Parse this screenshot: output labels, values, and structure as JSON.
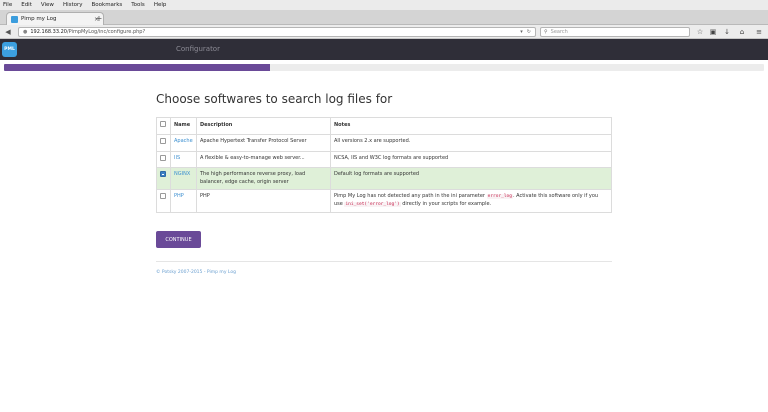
{
  "browser": {
    "menu": [
      "File",
      "Edit",
      "View",
      "History",
      "Bookmarks",
      "Tools",
      "Help"
    ],
    "tab_title": "Pimp my Log",
    "url_host": "192.168.33.20",
    "url_path": "/PimpMyLog/inc/configure.php?",
    "search_placeholder": "Search"
  },
  "app": {
    "logo_text": "PML",
    "title": "Configurator",
    "progress_fraction": 0.35,
    "accent_color": "#6a4a98"
  },
  "page": {
    "heading": "Choose softwares to search log files for",
    "columns": [
      "Name",
      "Description",
      "Notes"
    ],
    "rows": [
      {
        "name": "Apache",
        "description": "Apache Hypertext Transfer Protocol Server",
        "notes": "All versions 2.x are supported.",
        "checked": false
      },
      {
        "name": "IIS",
        "description": "A flexible & easy-to-manage web server...",
        "notes": "NCSA, IIS and W3C log formats are supported",
        "checked": false
      },
      {
        "name": "NGINX",
        "description": "The high performance reverse proxy, load balancer, edge cache, origin server",
        "notes": "Default log formats are supported",
        "checked": true
      },
      {
        "name": "PHP",
        "description": "PHP",
        "notes_part1": "Pimp My Log has not detected any path in the ini parameter",
        "notes_code1": "error_log",
        "notes_part2": ". Activate this software only if you use",
        "notes_code2": "ini_set('error_log')",
        "notes_part3": "directly in your scripts for example.",
        "checked": false
      }
    ],
    "continue_label": "CONTINUE",
    "footer": "© Potsky 2007-2015 - Pimp my Log"
  }
}
